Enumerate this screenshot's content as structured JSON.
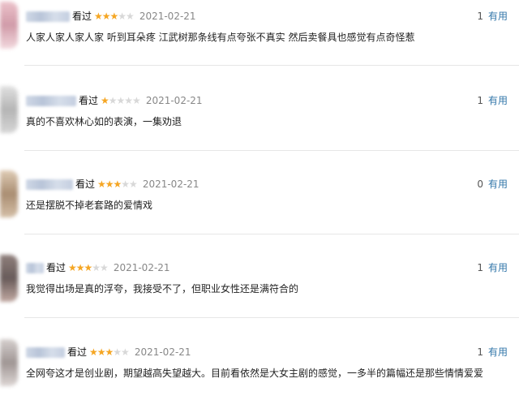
{
  "reviews": [
    {
      "watched_label": "看过",
      "rating": 3,
      "date": "2021-02-21",
      "useful_count": "1",
      "useful_label": "有用",
      "text": "人家人家人家人家 听到耳朵疼 江武树那条线有点夸张不真实 然后卖餐具也感觉有点奇怪惹"
    },
    {
      "watched_label": "看过",
      "rating": 1,
      "date": "2021-02-21",
      "useful_count": "1",
      "useful_label": "有用",
      "text": "真的不喜欢林心如的表演，一集劝退"
    },
    {
      "watched_label": "看过",
      "rating": 3,
      "date": "2021-02-21",
      "useful_count": "0",
      "useful_label": "有用",
      "text": "还是摆脱不掉老套路的爱情戏"
    },
    {
      "watched_label": "看过",
      "rating": 3,
      "date": "2021-02-21",
      "useful_count": "1",
      "useful_label": "有用",
      "text": "我觉得出场是真的浮夸，我接受不了，但职业女性还是满符合的"
    },
    {
      "watched_label": "看过",
      "rating": 3,
      "date": "2021-02-21",
      "useful_count": "1",
      "useful_label": "有用",
      "text": "全网夸这才是创业剧，期望越高失望越大。目前看依然是大女主剧的感觉，一多半的篇幅还是那些情情爱爱"
    }
  ],
  "colors": {
    "star_on": "#f5a623",
    "star_off": "#d8d8d8",
    "link": "#3377aa"
  }
}
